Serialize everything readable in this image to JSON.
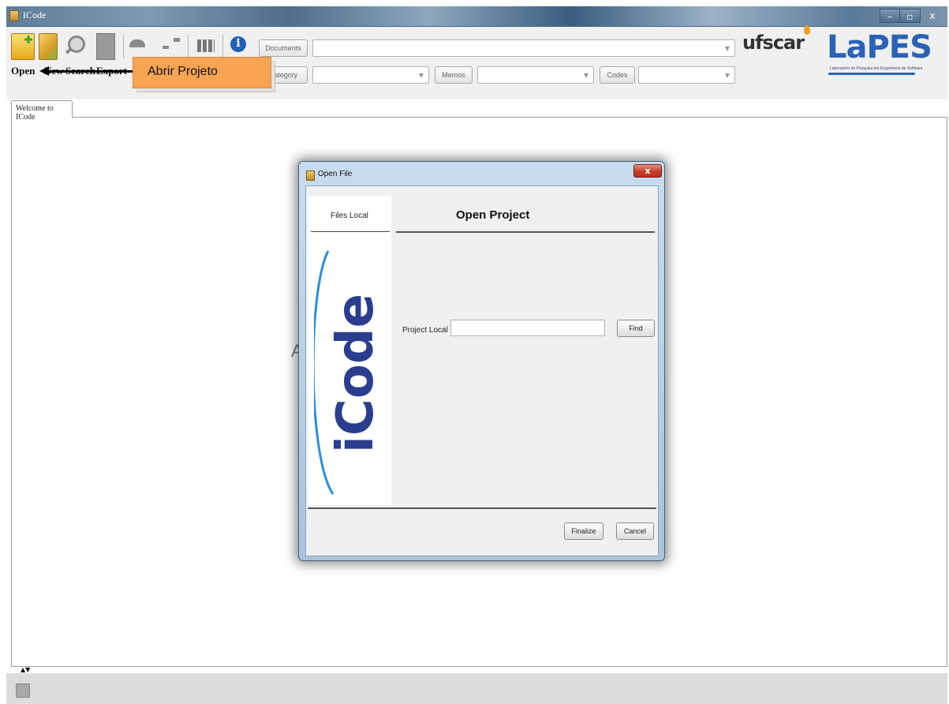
{
  "window": {
    "title": "ICode",
    "minimize": "–",
    "maximize": "▫",
    "close": "x"
  },
  "toolbar": {
    "open_label": "Open",
    "new_label": "New",
    "search_label": "Search",
    "export_label": "Export",
    "documents_label": "Documents",
    "category_label": "Category",
    "memos_label": "Memos",
    "codes_label": "Codes"
  },
  "logos": {
    "ufscar": "ufscar",
    "lapes": "LaPES",
    "lapes_subtitle": "Laboratório de Pesquisa em Engenharia de Software"
  },
  "callout": {
    "text": "Abrir Projeto"
  },
  "tabs": [
    {
      "label": "Welcome to ICode"
    }
  ],
  "background": {
    "partial_text": "A"
  },
  "dialog": {
    "title": "Open File",
    "close": "x",
    "side_label": "Files Local",
    "logo_text": "iCode",
    "heading": "Open  Project",
    "field_label": "Project Local",
    "field_value": "",
    "find_button": "Find",
    "finalize_button": "Finalize",
    "cancel_button": "Cancel"
  },
  "colors": {
    "callout": "#f7a453",
    "lapes_blue": "#2a63b6",
    "dialog_frame": "#a9c3dc"
  }
}
